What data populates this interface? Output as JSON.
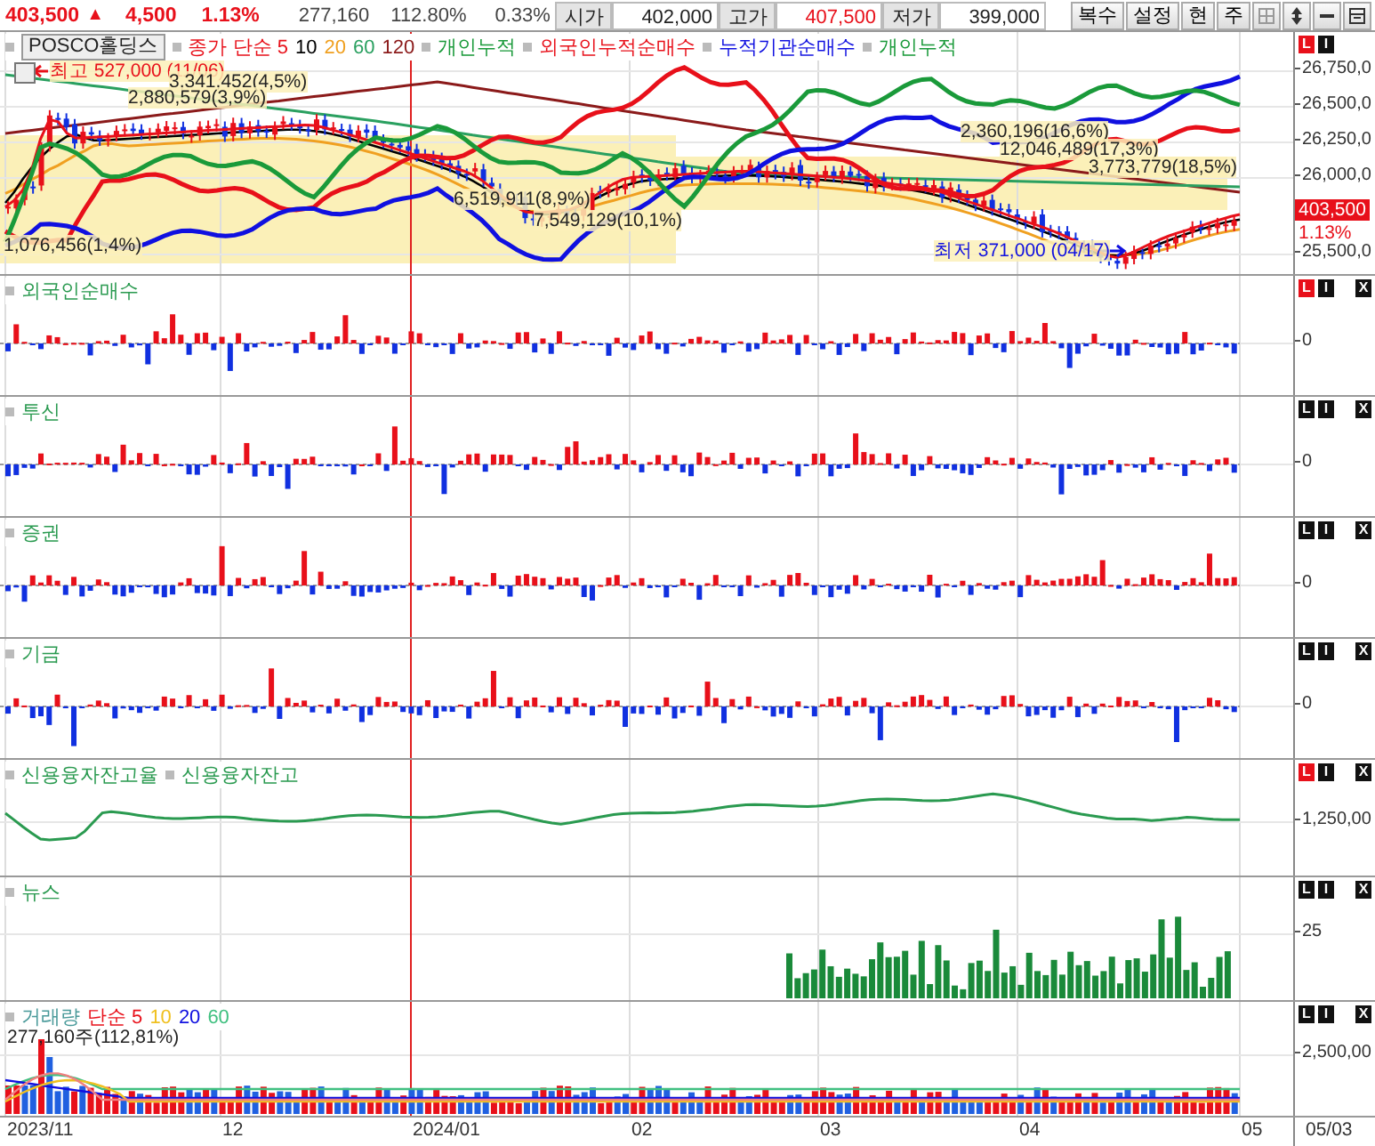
{
  "quote": {
    "price": "403,500",
    "arrow": "▲",
    "change": "4,500",
    "rate": "1.13%",
    "volume": "277,160",
    "volume_ratio": "112.80%",
    "turnover": "0.33%"
  },
  "fields": [
    {
      "label": "시가",
      "value": "402,000",
      "color": "#222222"
    },
    {
      "label": "고가",
      "value": "407,500",
      "color": "#e8101a"
    },
    {
      "label": "저가",
      "value": "399,000",
      "color": "#222222"
    }
  ],
  "buttons": [
    "복수",
    "설정",
    "현",
    "주"
  ],
  "panels": [
    {
      "kind": "price",
      "name": "POSCO홀딩스",
      "legend": [
        {
          "text": "종가 단순 5",
          "color": "#e8101a",
          "marker": true
        },
        {
          "text": "10",
          "color": "#000000",
          "marker": false
        },
        {
          "text": "20",
          "color": "#f0a020",
          "marker": false
        },
        {
          "text": "60",
          "color": "#2aa060",
          "marker": false
        },
        {
          "text": "120",
          "color": "#8b1a1a",
          "marker": false
        },
        {
          "text": "개인누적",
          "color": "#1a9a3a",
          "marker": true
        },
        {
          "text": "외국인누적순매수",
          "color": "#e8101a",
          "marker": true
        },
        {
          "text": "누적기관순매수",
          "color": "#1010e0",
          "marker": true
        },
        {
          "text": "개인누적",
          "color": "#1a9a3a",
          "marker": true
        }
      ],
      "badges": [
        {
          "label": "L",
          "on": true
        },
        {
          "label": "I",
          "on": false
        }
      ],
      "ticks": [
        "26,750,0",
        "26,500,0",
        "26,250,0",
        "26,000,0",
        "25,500,0"
      ],
      "price_tag": {
        "value": "403,500",
        "rate": "1.13%"
      },
      "annotations": [
        {
          "text": "최고 527,000 (11/06)",
          "color": "#e8101a"
        },
        {
          "text": "3,341,452(4,5%)",
          "color": "#222222"
        },
        {
          "text": "2,880,579(3,9%)",
          "color": "#222222"
        },
        {
          "text": "6,519,911(8,9%)",
          "color": "#222222"
        },
        {
          "text": "7,549,129(10,1%)",
          "color": "#222222"
        },
        {
          "text": "1,076,456(1,4%)",
          "color": "#222222"
        },
        {
          "text": "2,360,196(16,6%)",
          "color": "#222222"
        },
        {
          "text": "12,046,489(17,3%)",
          "color": "#222222"
        },
        {
          "text": "3,773,779(18,5%)",
          "color": "#222222"
        },
        {
          "text": "최저 371,000 (04/17)",
          "color": "#1010e0"
        }
      ]
    },
    {
      "kind": "flow",
      "legend": [
        {
          "text": "외국인순매수",
          "color": "#2a9a50",
          "marker": true
        }
      ],
      "badges": [
        {
          "label": "L",
          "on": true
        },
        {
          "label": "I",
          "on": false
        },
        {
          "label": "X",
          "on": false
        }
      ],
      "ticks": [
        "0"
      ]
    },
    {
      "kind": "flow",
      "legend": [
        {
          "text": "투신",
          "color": "#2a9a50",
          "marker": true
        }
      ],
      "badges": [
        {
          "label": "L",
          "on": false
        },
        {
          "label": "I",
          "on": false
        },
        {
          "label": "X",
          "on": false
        }
      ],
      "ticks": [
        "0"
      ]
    },
    {
      "kind": "flow",
      "legend": [
        {
          "text": "증권",
          "color": "#2a9a50",
          "marker": true
        }
      ],
      "badges": [
        {
          "label": "L",
          "on": false
        },
        {
          "label": "I",
          "on": false
        },
        {
          "label": "X",
          "on": false
        }
      ],
      "ticks": [
        "0"
      ]
    },
    {
      "kind": "flow",
      "legend": [
        {
          "text": "기금",
          "color": "#2a9a50",
          "marker": true
        }
      ],
      "badges": [
        {
          "label": "L",
          "on": false
        },
        {
          "label": "I",
          "on": false
        },
        {
          "label": "X",
          "on": false
        }
      ],
      "ticks": [
        "0"
      ]
    },
    {
      "kind": "line",
      "legend": [
        {
          "text": "신용융자잔고율",
          "color": "#2a9a50",
          "marker": true
        },
        {
          "text": "신용융자잔고",
          "color": "#2a9a50",
          "marker": true
        }
      ],
      "badges": [
        {
          "label": "L",
          "on": true
        },
        {
          "label": "I",
          "on": false
        },
        {
          "label": "X",
          "on": false
        }
      ],
      "ticks": [
        "1,250,00"
      ]
    },
    {
      "kind": "news",
      "legend": [
        {
          "text": "뉴스",
          "color": "#2a9a50",
          "marker": true
        }
      ],
      "badges": [
        {
          "label": "L",
          "on": false
        },
        {
          "label": "I",
          "on": false
        },
        {
          "label": "X",
          "on": false
        }
      ],
      "ticks": [
        "25"
      ]
    },
    {
      "kind": "volume",
      "legend": [
        {
          "text": "거래량",
          "color": "#4a9a9a",
          "marker": true
        },
        {
          "text": "단순 5",
          "color": "#e8101a",
          "marker": false
        },
        {
          "text": "10",
          "color": "#f0c020",
          "marker": false
        },
        {
          "text": "20",
          "color": "#1010e0",
          "marker": false
        },
        {
          "text": "60",
          "color": "#40c080",
          "marker": false
        }
      ],
      "badges": [
        {
          "label": "L",
          "on": false
        },
        {
          "label": "I",
          "on": false
        },
        {
          "label": "X",
          "on": false
        }
      ],
      "ticks": [
        "2,500,00"
      ],
      "note": "277,160주(112,81%)"
    }
  ],
  "x_axis": {
    "labels": [
      "2023/11",
      "12",
      "2024/01",
      "02",
      "03",
      "04",
      "05"
    ],
    "corner": "05/03"
  }
}
